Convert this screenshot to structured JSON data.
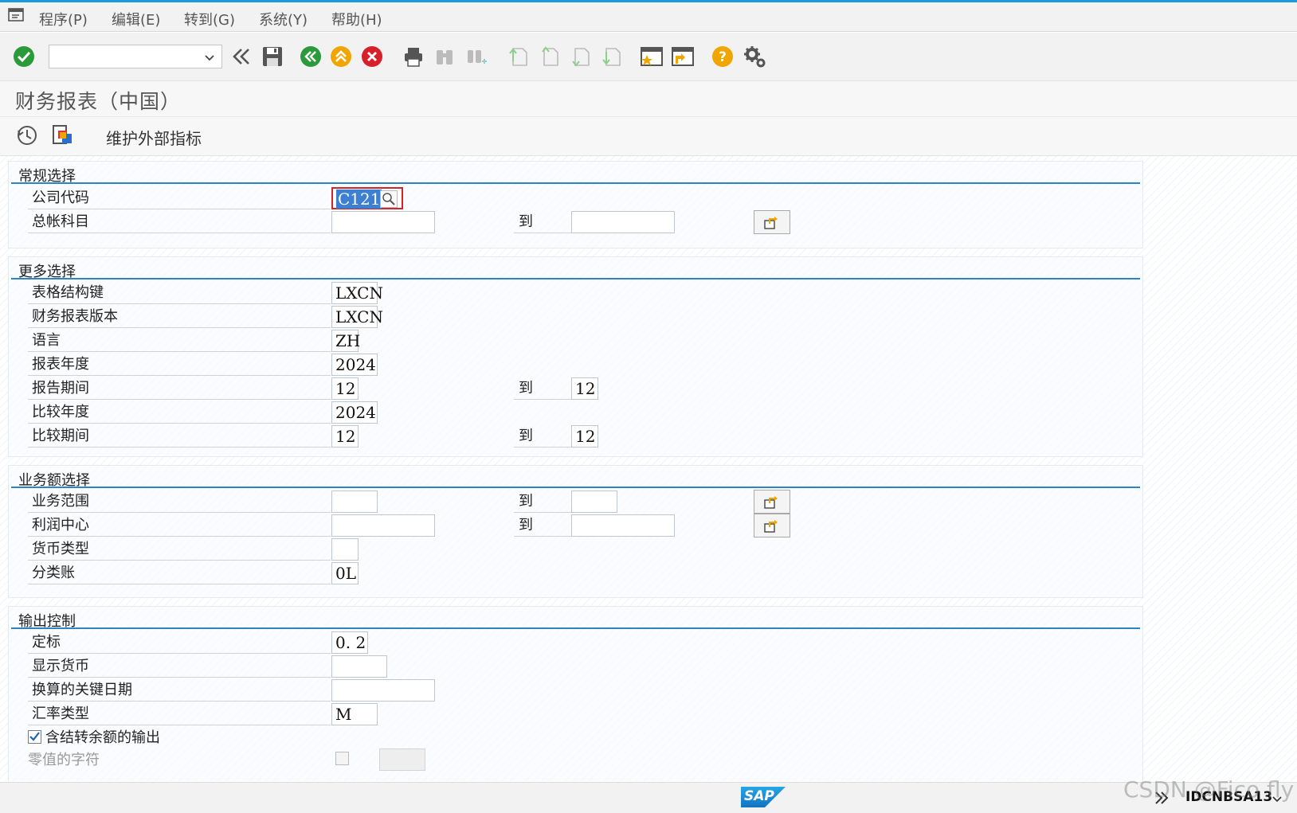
{
  "menubar": {
    "items": [
      {
        "label": "程序(P)"
      },
      {
        "label": "编辑(E)"
      },
      {
        "label": "转到(G)"
      },
      {
        "label": "系统(Y)"
      },
      {
        "label": "帮助(H)"
      }
    ]
  },
  "toolbar": {
    "command_field_value": "",
    "icons": [
      "enter-icon",
      "command-dropdown",
      "back-icon",
      "save-icon",
      "back-green-icon",
      "exit-icon",
      "cancel-icon",
      "print-icon",
      "find-icon",
      "find-next-icon",
      "first-page-icon",
      "previous-page-icon",
      "next-page-icon",
      "last-page-icon",
      "create-session-icon",
      "shortcut-icon",
      "help-icon",
      "settings-icon"
    ]
  },
  "title": "财务报表（中国）",
  "app_toolbar": {
    "execute_icon": "execute-icon",
    "variant_icon": "get-variant-icon",
    "maintain_label": "维护外部指标"
  },
  "groups": {
    "general": {
      "title": "常规选择",
      "company_code": {
        "label": "公司代码",
        "value": "C121"
      },
      "gl_account": {
        "label": "总帐科目",
        "from": "",
        "to_label": "到",
        "to": ""
      }
    },
    "more": {
      "title": "更多选择",
      "structure_key": {
        "label": "表格结构键",
        "value": "LXCN"
      },
      "fs_version": {
        "label": "财务报表版本",
        "value": "LXCN"
      },
      "language": {
        "label": "语言",
        "value": "ZH"
      },
      "report_year": {
        "label": "报表年度",
        "value": "2024"
      },
      "report_period": {
        "label": "报告期间",
        "from": "12",
        "to_label": "到",
        "to": "12"
      },
      "compare_year": {
        "label": "比较年度",
        "value": "2024"
      },
      "compare_period": {
        "label": "比较期间",
        "from": "12",
        "to_label": "到",
        "to": "12"
      }
    },
    "business": {
      "title": "业务额选择",
      "business_area": {
        "label": "业务范围",
        "from": "",
        "to_label": "到",
        "to": ""
      },
      "profit_center": {
        "label": "利润中心",
        "from": "",
        "to_label": "到",
        "to": ""
      },
      "currency_type": {
        "label": "货币类型",
        "value": ""
      },
      "ledger": {
        "label": "分类账",
        "value": "0L"
      }
    },
    "output": {
      "title": "输出控制",
      "scale": {
        "label": "定标",
        "value": "0. 2"
      },
      "display_currency": {
        "label": "显示货币",
        "value": ""
      },
      "key_date": {
        "label": "换算的关键日期",
        "value": ""
      },
      "rate_type": {
        "label": "汇率类型",
        "value": "M"
      },
      "carry_forward": {
        "label": "含结转余额的输出",
        "checked": true
      },
      "zero_value": {
        "label": "零值的字符",
        "value": ""
      }
    }
  },
  "statusbar": {
    "logo": "SAP",
    "transaction": "IDCNBSA13",
    "watermark": "CSDN @Fico fly"
  }
}
